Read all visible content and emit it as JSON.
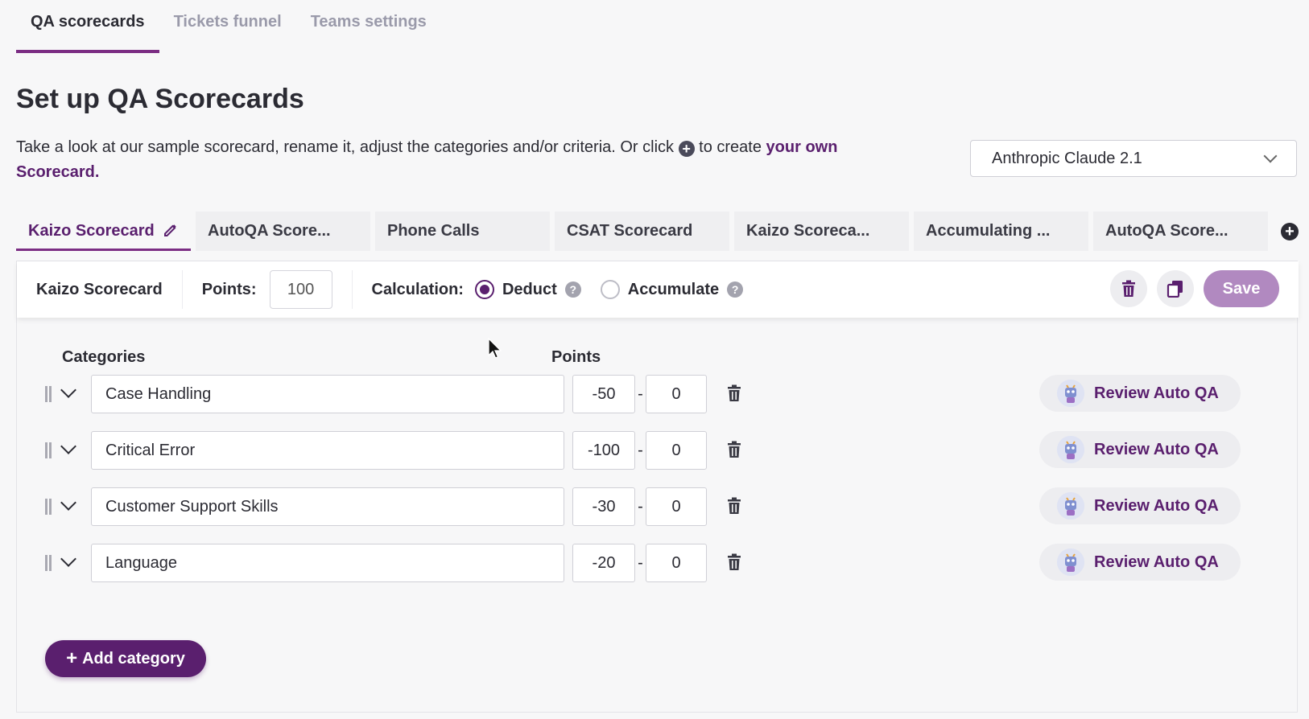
{
  "top_tabs": [
    {
      "label": "QA scorecards",
      "active": true
    },
    {
      "label": "Tickets funnel",
      "active": false
    },
    {
      "label": "Teams settings",
      "active": false
    }
  ],
  "page_title": "Set up QA Scorecards",
  "intro": {
    "text_before": "Take a look at our sample scorecard, rename it, adjust the categories and/or criteria. Or click",
    "text_after": "to create",
    "link_text": "your own Scorecard."
  },
  "model_select": {
    "value": "Anthropic Claude 2.1"
  },
  "scorecard_tabs": [
    {
      "label": "Kaizo Scorecard",
      "active": true
    },
    {
      "label": "AutoQA Score...",
      "active": false
    },
    {
      "label": "Phone Calls",
      "active": false
    },
    {
      "label": "CSAT Scorecard",
      "active": false
    },
    {
      "label": "Kaizo Scoreca...",
      "active": false
    },
    {
      "label": "Accumulating ...",
      "active": false
    },
    {
      "label": "AutoQA Score...",
      "active": false
    }
  ],
  "toolbar": {
    "name": "Kaizo Scorecard",
    "points_label": "Points:",
    "points_value": "100",
    "calculation_label": "Calculation:",
    "deduct_label": "Deduct",
    "accumulate_label": "Accumulate",
    "selected_calculation": "Deduct",
    "save_label": "Save"
  },
  "columns": {
    "categories": "Categories",
    "points": "Points"
  },
  "categories": [
    {
      "name": "Case Handling",
      "min": "-50",
      "max": "0",
      "review_label": "Review Auto QA"
    },
    {
      "name": "Critical Error",
      "min": "-100",
      "max": "0",
      "review_label": "Review Auto QA"
    },
    {
      "name": "Customer Support Skills",
      "min": "-30",
      "max": "0",
      "review_label": "Review Auto QA"
    },
    {
      "name": "Language",
      "min": "-20",
      "max": "0",
      "review_label": "Review Auto QA"
    }
  ],
  "add_category_label": "Add category",
  "colors": {
    "brand": "#5a1f6e",
    "accent_underline": "#7b2d83",
    "save_disabled": "#b189c0"
  }
}
